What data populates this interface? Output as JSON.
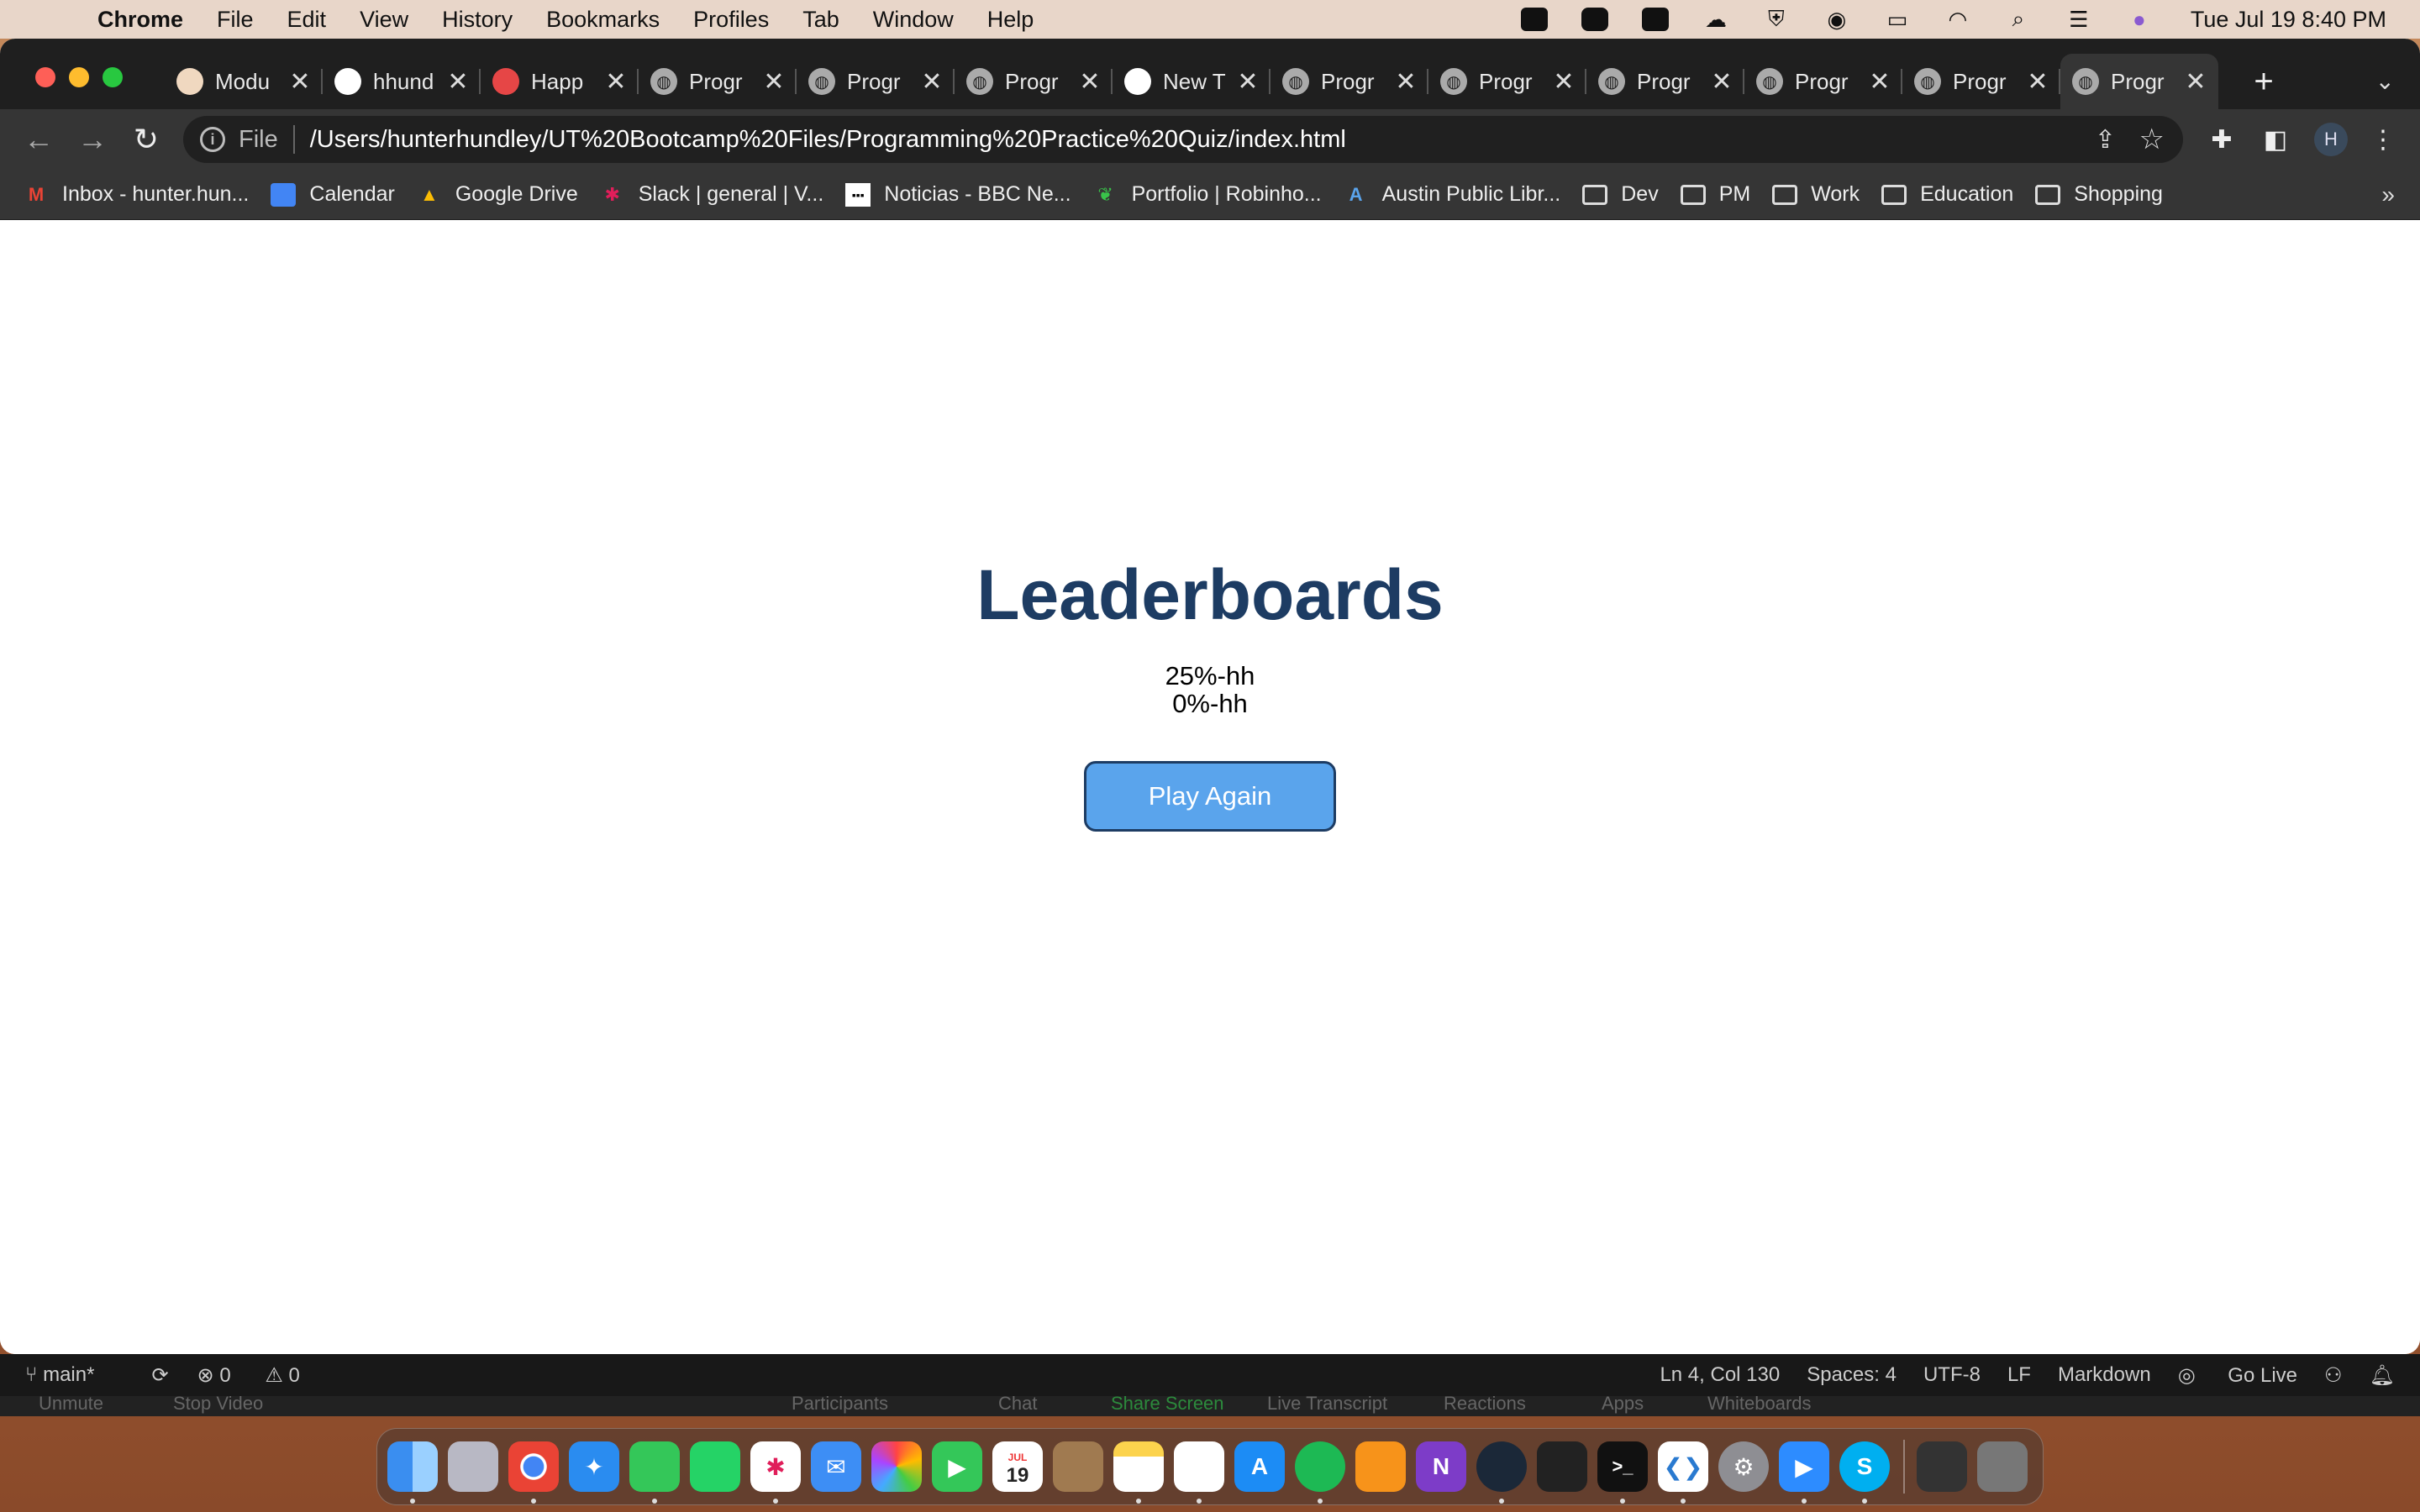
{
  "menubar": {
    "app": "Chrome",
    "items": [
      "File",
      "Edit",
      "View",
      "History",
      "Bookmarks",
      "Profiles",
      "Tab",
      "Window",
      "Help"
    ],
    "clock": "Tue Jul 19  8:40 PM"
  },
  "tabs": [
    {
      "title": "Modu"
    },
    {
      "title": "hhund"
    },
    {
      "title": "Happ"
    },
    {
      "title": "Progr"
    },
    {
      "title": "Progr"
    },
    {
      "title": "Progr"
    },
    {
      "title": "New T"
    },
    {
      "title": "Progr"
    },
    {
      "title": "Progr"
    },
    {
      "title": "Progr"
    },
    {
      "title": "Progr"
    },
    {
      "title": "Progr"
    },
    {
      "title": "Progr"
    }
  ],
  "omnibox": {
    "scheme": "File",
    "url": "/Users/hunterhundley/UT%20Bootcamp%20Files/Programming%20Practice%20Quiz/index.html"
  },
  "profile_initial": "H",
  "bookmarks": [
    {
      "label": "Inbox - hunter.hun..."
    },
    {
      "label": "Calendar"
    },
    {
      "label": "Google Drive"
    },
    {
      "label": "Slack | general | V..."
    },
    {
      "label": "Noticias - BBC Ne..."
    },
    {
      "label": "Portfolio | Robinho..."
    },
    {
      "label": "Austin Public Libr..."
    },
    {
      "label": "Dev"
    },
    {
      "label": "PM"
    },
    {
      "label": "Work"
    },
    {
      "label": "Education"
    },
    {
      "label": "Shopping"
    }
  ],
  "page": {
    "title": "Leaderboards",
    "scores": [
      "25%-hh",
      "0%-hh"
    ],
    "play_again": "Play Again"
  },
  "statusbar": {
    "branch": "main*",
    "errors": "0",
    "warnings": "0",
    "position": "Ln 4, Col 130",
    "spaces": "Spaces: 4",
    "encoding": "UTF-8",
    "eol": "LF",
    "language": "Markdown",
    "golive": "Go Live"
  },
  "zoombar": {
    "unmute": "Unmute",
    "stop_video": "Stop Video",
    "participants": "Participants",
    "chat": "Chat",
    "share_screen": "Share Screen",
    "live_transcript": "Live Transcript",
    "reactions": "Reactions",
    "apps": "Apps",
    "whiteboards": "Whiteboards"
  },
  "calendar_icon": {
    "month": "JUL",
    "day": "19"
  },
  "colors": {
    "heading": "#1d3c63",
    "button_bg": "#5aa4ec",
    "button_border": "#1d3c63"
  }
}
